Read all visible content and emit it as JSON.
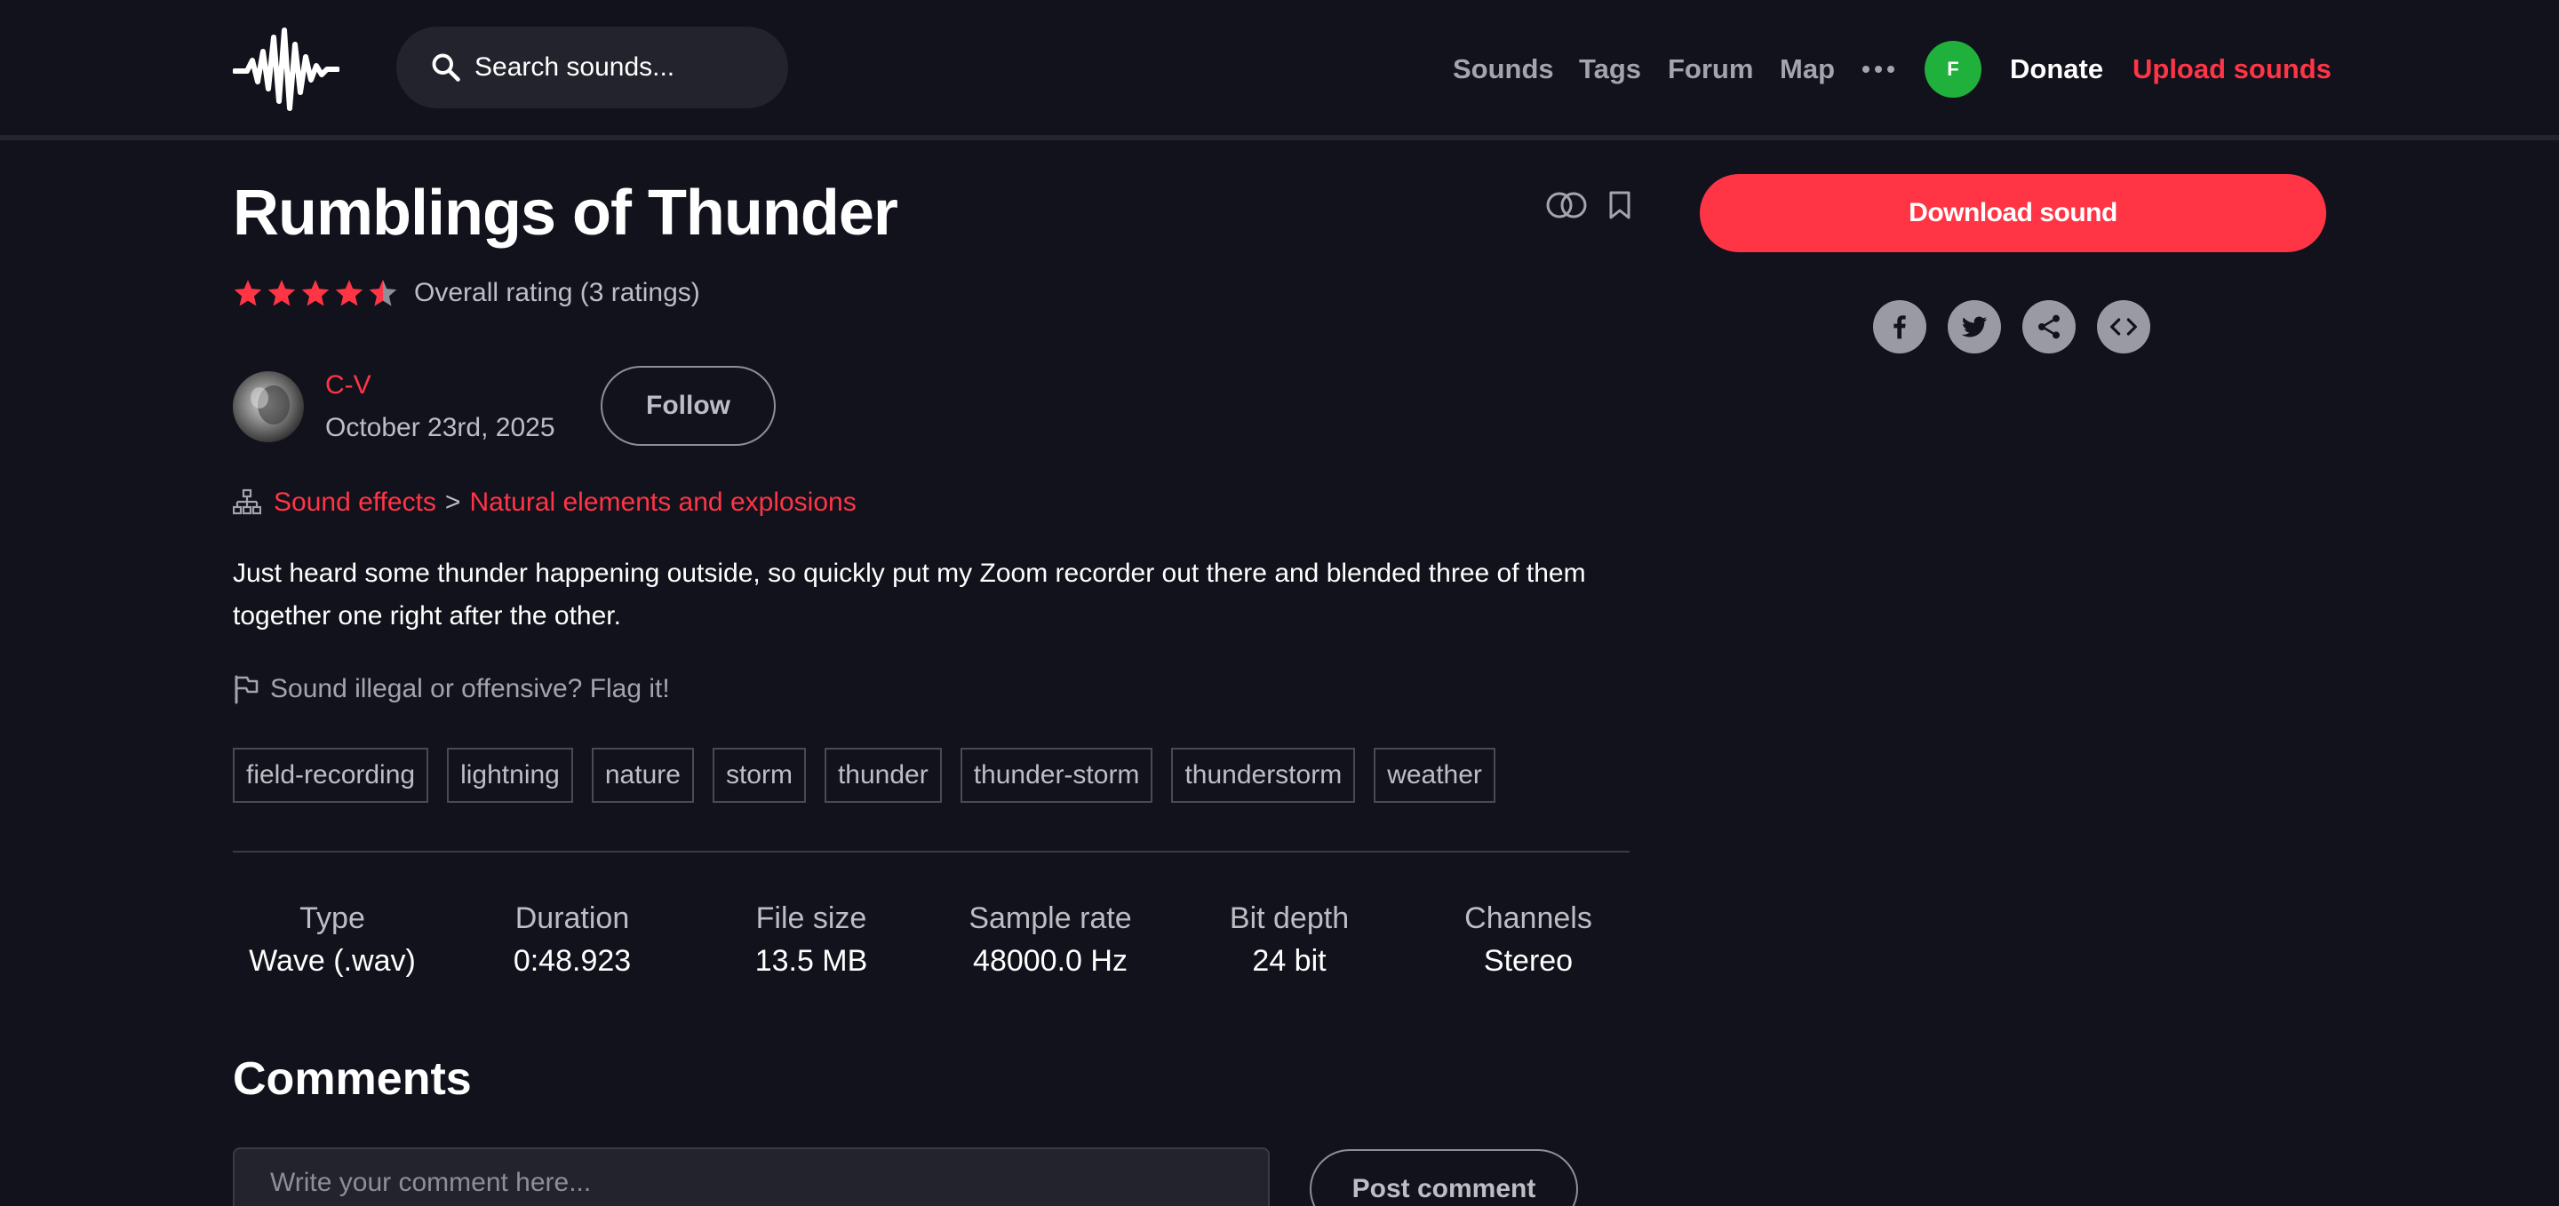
{
  "nav": {
    "search_placeholder": "Search sounds...",
    "links": {
      "sounds": "Sounds",
      "tags": "Tags",
      "forum": "Forum",
      "map": "Map"
    },
    "user_initial": "F",
    "donate": "Donate",
    "upload": "Upload sounds"
  },
  "sound": {
    "title": "Rumblings of Thunder",
    "rating_value": 4.5,
    "rating_text": "Overall rating (3 ratings)",
    "author": "C-V",
    "date": "October 23rd, 2025",
    "follow_label": "Follow",
    "category": "Sound effects",
    "category_separator": ">",
    "subcategory": "Natural elements and explosions",
    "description": "Just heard some thunder happening outside, so quickly put my Zoom recorder out there and blended three of them together one right after the other.",
    "flag_text": "Sound illegal or offensive? Flag it!",
    "tags": [
      "field-recording",
      "lightning",
      "nature",
      "storm",
      "thunder",
      "thunder-storm",
      "thunderstorm",
      "weather"
    ],
    "specs": [
      {
        "label": "Type",
        "value": "Wave (.wav)"
      },
      {
        "label": "Duration",
        "value": "0:48.923"
      },
      {
        "label": "File size",
        "value": "13.5 MB"
      },
      {
        "label": "Sample rate",
        "value": "48000.0 Hz"
      },
      {
        "label": "Bit depth",
        "value": "24 bit"
      },
      {
        "label": "Channels",
        "value": "Stereo"
      }
    ]
  },
  "comments": {
    "title": "Comments",
    "placeholder": "Write your comment here...",
    "post_label": "Post comment"
  },
  "sidebar": {
    "download_label": "Download sound",
    "share_icons": [
      "facebook-icon",
      "twitter-icon",
      "share-icon",
      "embed-icon"
    ]
  },
  "colors": {
    "background": "#12121c",
    "accent": "#ff3546",
    "avatar": "#20b03c",
    "muted": "#a4a4ae"
  }
}
